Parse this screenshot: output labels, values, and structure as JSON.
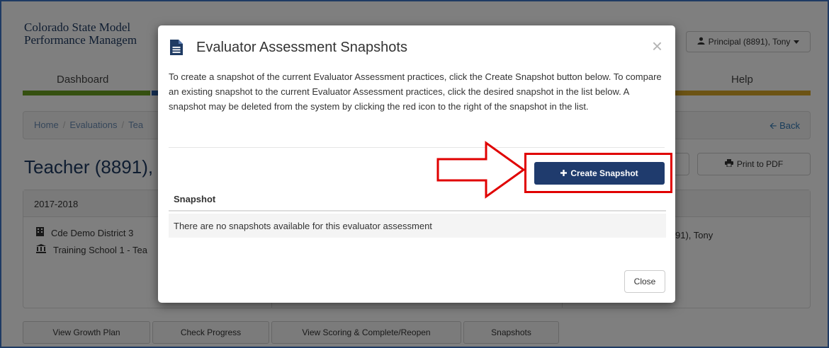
{
  "app": {
    "brand_line1": "Colorado State Model",
    "brand_line2": "Performance Managem",
    "user_label": "Principal (8891), Tony"
  },
  "nav": {
    "items": [
      {
        "label": "Dashboard",
        "color": "#6aa121"
      },
      {
        "label": "Help",
        "color": "#d9a728"
      }
    ]
  },
  "breadcrumb": {
    "home": "Home",
    "evaluations": "Evaluations",
    "current": "Tea",
    "back_label": "Back"
  },
  "page": {
    "title": "Teacher (8891),",
    "print_label": "Print to PDF"
  },
  "panel": {
    "year": "2017-2018",
    "district": "Cde Demo District 3",
    "school": "Training School 1 - Tea",
    "evaluator_partial": "91), Tony"
  },
  "bottom_buttons": [
    {
      "label": "View Growth Plan"
    },
    {
      "label": "Check Progress"
    },
    {
      "label": "View Scoring & Complete/Reopen"
    },
    {
      "label": "Snapshots"
    }
  ],
  "modal": {
    "title": "Evaluator Assessment Snapshots",
    "description": "To create a snapshot of the current Evaluator Assessment practices, click the Create Snapshot button below. To compare an existing snapshot to the current Evaluator Assessment practices, click the desired snapshot in the list below. A snapshot may be deleted from the system by clicking the red icon to the right of the snapshot in the list.",
    "create_button": "Create Snapshot",
    "table_header": "Snapshot",
    "empty_message": "There are no snapshots available for this evaluator assessment",
    "close_button": "Close"
  },
  "colors": {
    "primary": "#1f3b6d",
    "highlight": "#e00000"
  }
}
